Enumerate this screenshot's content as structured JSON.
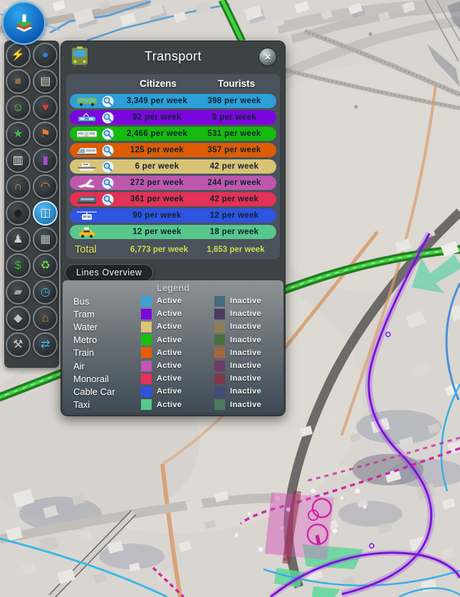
{
  "info_button": {
    "name": "info-views",
    "tooltip_glyph": "layers"
  },
  "toolbar": {
    "items": [
      {
        "name": "electricity",
        "glyph": "⚡",
        "color": "#49aef2"
      },
      {
        "name": "water",
        "glyph": "●",
        "color": "#2f82d8"
      },
      {
        "name": "garbage",
        "glyph": "■",
        "color": "#8f6c48"
      },
      {
        "name": "education",
        "glyph": "▤",
        "color": "#e9e0c2"
      },
      {
        "name": "happiness",
        "glyph": "☺",
        "color": "#7de13c"
      },
      {
        "name": "health",
        "glyph": "♥",
        "color": "#e23c3c"
      },
      {
        "name": "land-value",
        "glyph": "★",
        "color": "#4cb84c"
      },
      {
        "name": "wind",
        "glyph": "⚑",
        "color": "#ea7c2a"
      },
      {
        "name": "traffic",
        "glyph": "▥",
        "color": "#eef2f4"
      },
      {
        "name": "pollution",
        "glyph": "▮",
        "color": "#a44cdb"
      },
      {
        "name": "noise",
        "glyph": "∩",
        "color": "#dba452"
      },
      {
        "name": "fire-safety",
        "glyph": "◠",
        "color": "#ea982a"
      },
      {
        "name": "crime",
        "glyph": "☻",
        "color": "#1b2124"
      },
      {
        "name": "public-transport",
        "glyph": "◫",
        "color": "#ffffff"
      },
      {
        "name": "population",
        "glyph": "♟",
        "color": "#c9cdd1"
      },
      {
        "name": "city-buildings",
        "glyph": "▦",
        "color": "#b9c3cc"
      },
      {
        "name": "economy",
        "glyph": "$",
        "color": "#37c637"
      },
      {
        "name": "natural-resources",
        "glyph": "♻",
        "color": "#6cda4c"
      },
      {
        "name": "terrain",
        "glyph": "▰",
        "color": "#9ba5ad"
      },
      {
        "name": "entertainment",
        "glyph": "◷",
        "color": "#4cb2ea"
      },
      {
        "name": "terrain-height",
        "glyph": "◆",
        "color": "#b9c5cd"
      },
      {
        "name": "tourism",
        "glyph": "⌂",
        "color": "#ea982a"
      },
      {
        "name": "maintenance",
        "glyph": "⚒",
        "color": "#c9cdd1"
      },
      {
        "name": "routes",
        "glyph": "⇄",
        "color": "#4cb2ea"
      }
    ]
  },
  "panel": {
    "title": "Transport",
    "icon": "bus",
    "close_glyph": "×",
    "columns": {
      "citizens": "Citizens",
      "tourists": "Tourists"
    },
    "rows": [
      {
        "name": "Bus",
        "icon": "bus",
        "citizens": "3,349 per week",
        "tourists": "398 per week",
        "color": "#2d9fd9",
        "magnifier": true
      },
      {
        "name": "Tram",
        "icon": "tram",
        "citizens": "92 per week",
        "tourists": "9 per week",
        "color": "#7b06dd",
        "magnifier": true
      },
      {
        "name": "Metro",
        "icon": "metro",
        "citizens": "2,466 per week",
        "tourists": "531 per week",
        "color": "#16b90e",
        "magnifier": true
      },
      {
        "name": "Train",
        "icon": "train",
        "citizens": "125 per week",
        "tourists": "357 per week",
        "color": "#dd5c04",
        "magnifier": true
      },
      {
        "name": "Ship",
        "icon": "ship",
        "citizens": "6 per week",
        "tourists": "42 per week",
        "color": "#d9c377",
        "magnifier": true
      },
      {
        "name": "Air",
        "icon": "plane",
        "citizens": "272 per week",
        "tourists": "244 per week",
        "color": "#bd57ae",
        "magnifier": true
      },
      {
        "name": "Monorail",
        "icon": "monorail",
        "citizens": "361 per week",
        "tourists": "42 per week",
        "color": "#e23255",
        "magnifier": true
      },
      {
        "name": "Cable Car",
        "icon": "cable-car",
        "citizens": "90 per week",
        "tourists": "12 per week",
        "color": "#2e54e2",
        "magnifier": false
      },
      {
        "name": "Taxi",
        "icon": "taxi",
        "citizens": "12 per week",
        "tourists": "18 per week",
        "color": "#58c78b",
        "magnifier": false
      }
    ],
    "total": {
      "label": "Total",
      "citizens": "6,773 per week",
      "tourists": "1,653 per week"
    },
    "lines_overview_label": "Lines Overview",
    "legend": {
      "title": "Legend",
      "active_label": "Active",
      "inactive_label": "Inactive",
      "rows": [
        {
          "label": "Bus",
          "active": "#3da0d4",
          "inactive": "#46697e"
        },
        {
          "label": "Tram",
          "active": "#7a06dd",
          "inactive": "#4c3a63"
        },
        {
          "label": "Water",
          "active": "#dcc479",
          "inactive": "#8d7f55"
        },
        {
          "label": "Metro",
          "active": "#16c40c",
          "inactive": "#49703c"
        },
        {
          "label": "Train",
          "active": "#e55d04",
          "inactive": "#a2663e"
        },
        {
          "label": "Air",
          "active": "#c058b1",
          "inactive": "#6d3c64"
        },
        {
          "label": "Monorail",
          "active": "#e8315b",
          "inactive": "#7c3a49"
        },
        {
          "label": "Cable Car",
          "active": "#2d52e5",
          "inactive": "#454a74"
        },
        {
          "label": "Taxi",
          "active": "#57ca86",
          "inactive": "#4d7a5c"
        }
      ]
    }
  }
}
